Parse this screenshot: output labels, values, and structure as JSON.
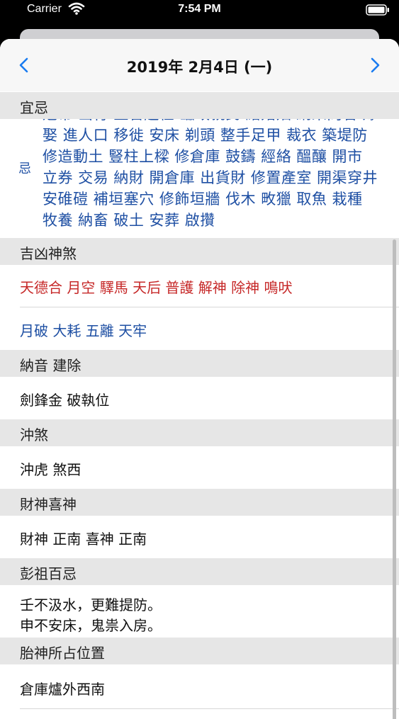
{
  "status_bar": {
    "carrier": "Carrier",
    "time": "7:54 PM"
  },
  "nav": {
    "title": "2019年 2月4日 (一)",
    "prev_icon": "chevron-left-icon",
    "next_icon": "chevron-right-icon"
  },
  "sections": {
    "yi_ji": {
      "header": "宜忌",
      "ji_label": "忌",
      "ji_text": "冠帶 出行 上官赴任 臨政親民 結婚姻 納采問名 嫁娶 進人口 移徙 安床 剃頭 整手足甲 裁衣 築堤防 修造動土 豎柱上樑 修倉庫 鼓鑄 經絡 醞釀 開市 立券 交易 納財 開倉庫 出貨財 修置產室 開渠穿井 安碓磑 補垣塞穴 修飾垣牆 伐木 畋獵 取魚 栽種 牧養 納畜 破土 安葬 啟攢"
    },
    "shensha": {
      "header": "吉凶神煞",
      "good": "天德合 月空 驛馬 天后 普護 解神 除神 鳴吠",
      "bad": "月破 大耗 五離 天牢"
    },
    "nayin": {
      "header": "納音 建除",
      "value": "劍鋒金  破執位"
    },
    "chongsha": {
      "header": "沖煞",
      "value": "沖虎  煞西"
    },
    "caishen": {
      "header": "財神喜神",
      "value": "財神 正南   喜神 正南"
    },
    "pengzu": {
      "header": "彭祖百忌",
      "line1": "壬不汲水，更難提防。",
      "line2": "申不安床，鬼祟入房。"
    },
    "taishen": {
      "header": "胎神所占位置",
      "value": "倉庫爐外西南"
    }
  },
  "colors": {
    "good": "#c62828",
    "bad": "#1e4fa3",
    "accent": "#1a7cf0"
  }
}
